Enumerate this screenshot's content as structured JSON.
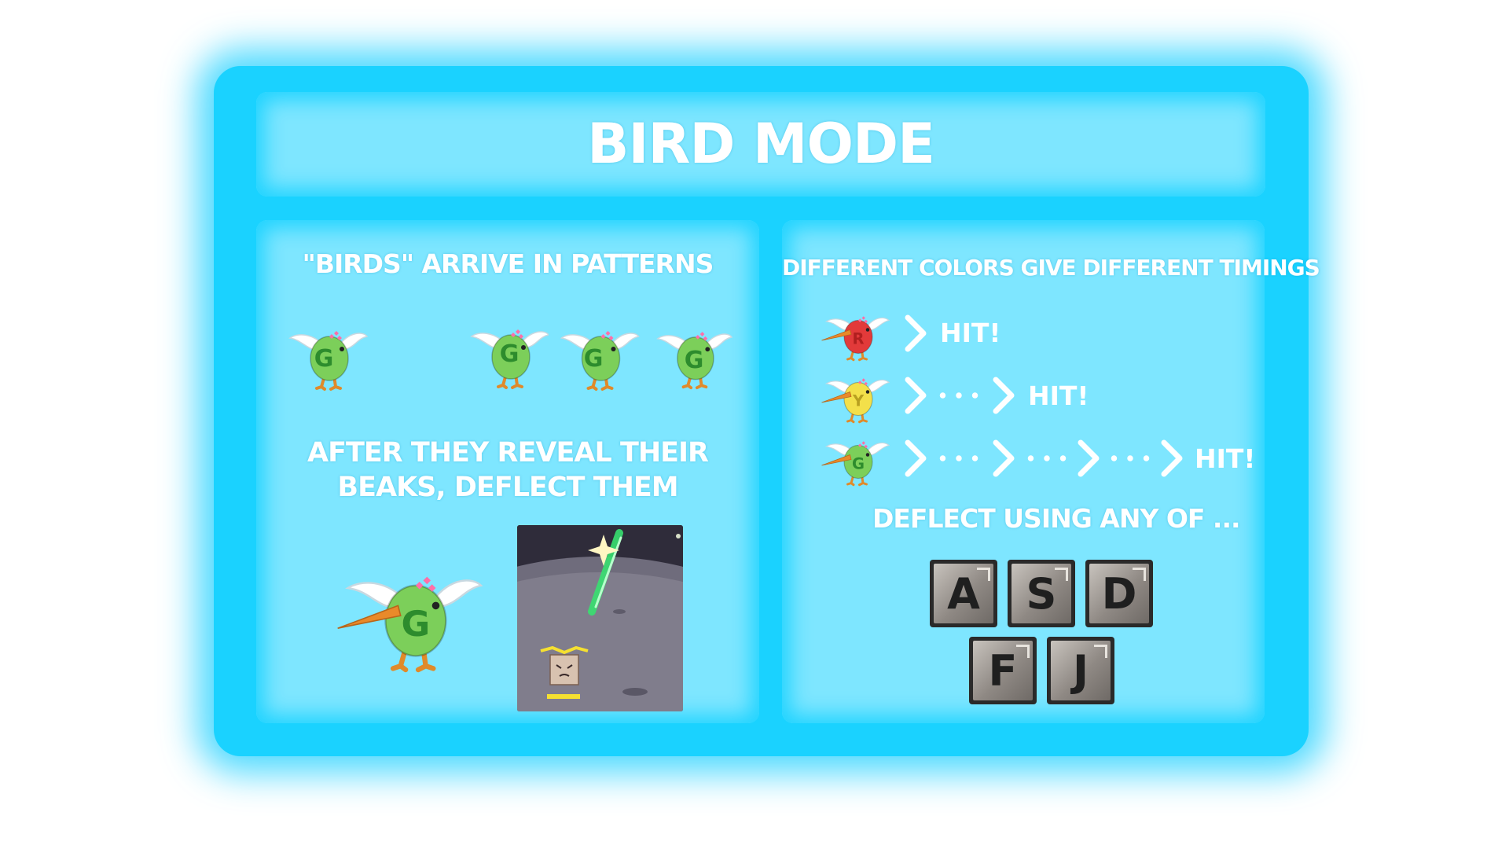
{
  "title": "Bird Mode",
  "left_panel": {
    "heading_patterns": "\"Birds\" arrive in patterns",
    "heading_deflect": "After they reveal their beaks, deflect them",
    "pattern_bird_letter": "G",
    "big_bird_letter": "G"
  },
  "right_panel": {
    "heading_colors": "Different colors give different timings",
    "timing_rows": [
      {
        "bird_color": "red",
        "letter": "R",
        "result": "Hit!"
      },
      {
        "bird_color": "yellow",
        "letter": "Y",
        "result": "Hit!"
      },
      {
        "bird_color": "green",
        "letter": "G",
        "result": "Hit!"
      }
    ],
    "heading_keys": "Deflect using any of ...",
    "keys": [
      "A",
      "S",
      "D",
      "F",
      "J"
    ]
  },
  "colors": {
    "frame": "#1ad2ff",
    "panel": "#7ee6ff",
    "bird_green": "#7ccf5a",
    "bird_red": "#e23a3a",
    "bird_yellow": "#f3e04a",
    "beak": "#e98a2a"
  }
}
